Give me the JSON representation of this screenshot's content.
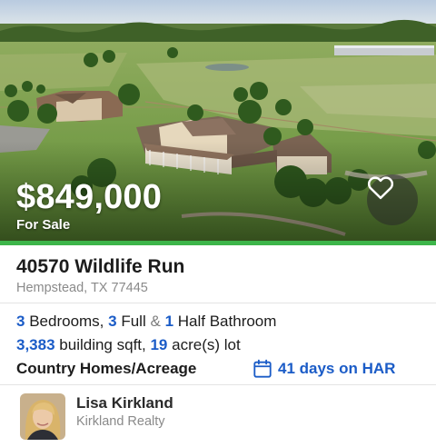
{
  "listing": {
    "price": "$849,000",
    "status": "For Sale",
    "address": {
      "street": "40570 Wildlife Run",
      "city_state_zip": "Hempstead, TX 77445"
    },
    "beds": "3",
    "beds_label": "Bedrooms,",
    "full_baths": "3",
    "full_baths_label": "Full",
    "amp": "&",
    "half_baths": "1",
    "half_baths_label": "Half Bathroom",
    "sqft": "3,383",
    "sqft_label": "building sqft,",
    "acres": "19",
    "acres_label": "acre(s) lot",
    "property_type": "Country Homes/Acreage",
    "days_on_market": "41 days on HAR"
  },
  "agent": {
    "name": "Lisa Kirkland",
    "firm": "Kirkland Realty"
  },
  "icons": {
    "favorite": "heart-outline-icon",
    "calendar": "calendar-icon"
  },
  "colors": {
    "accent_blue": "#1b5cc7",
    "status_green": "#3db54a",
    "muted_text": "#8a8a8a"
  }
}
